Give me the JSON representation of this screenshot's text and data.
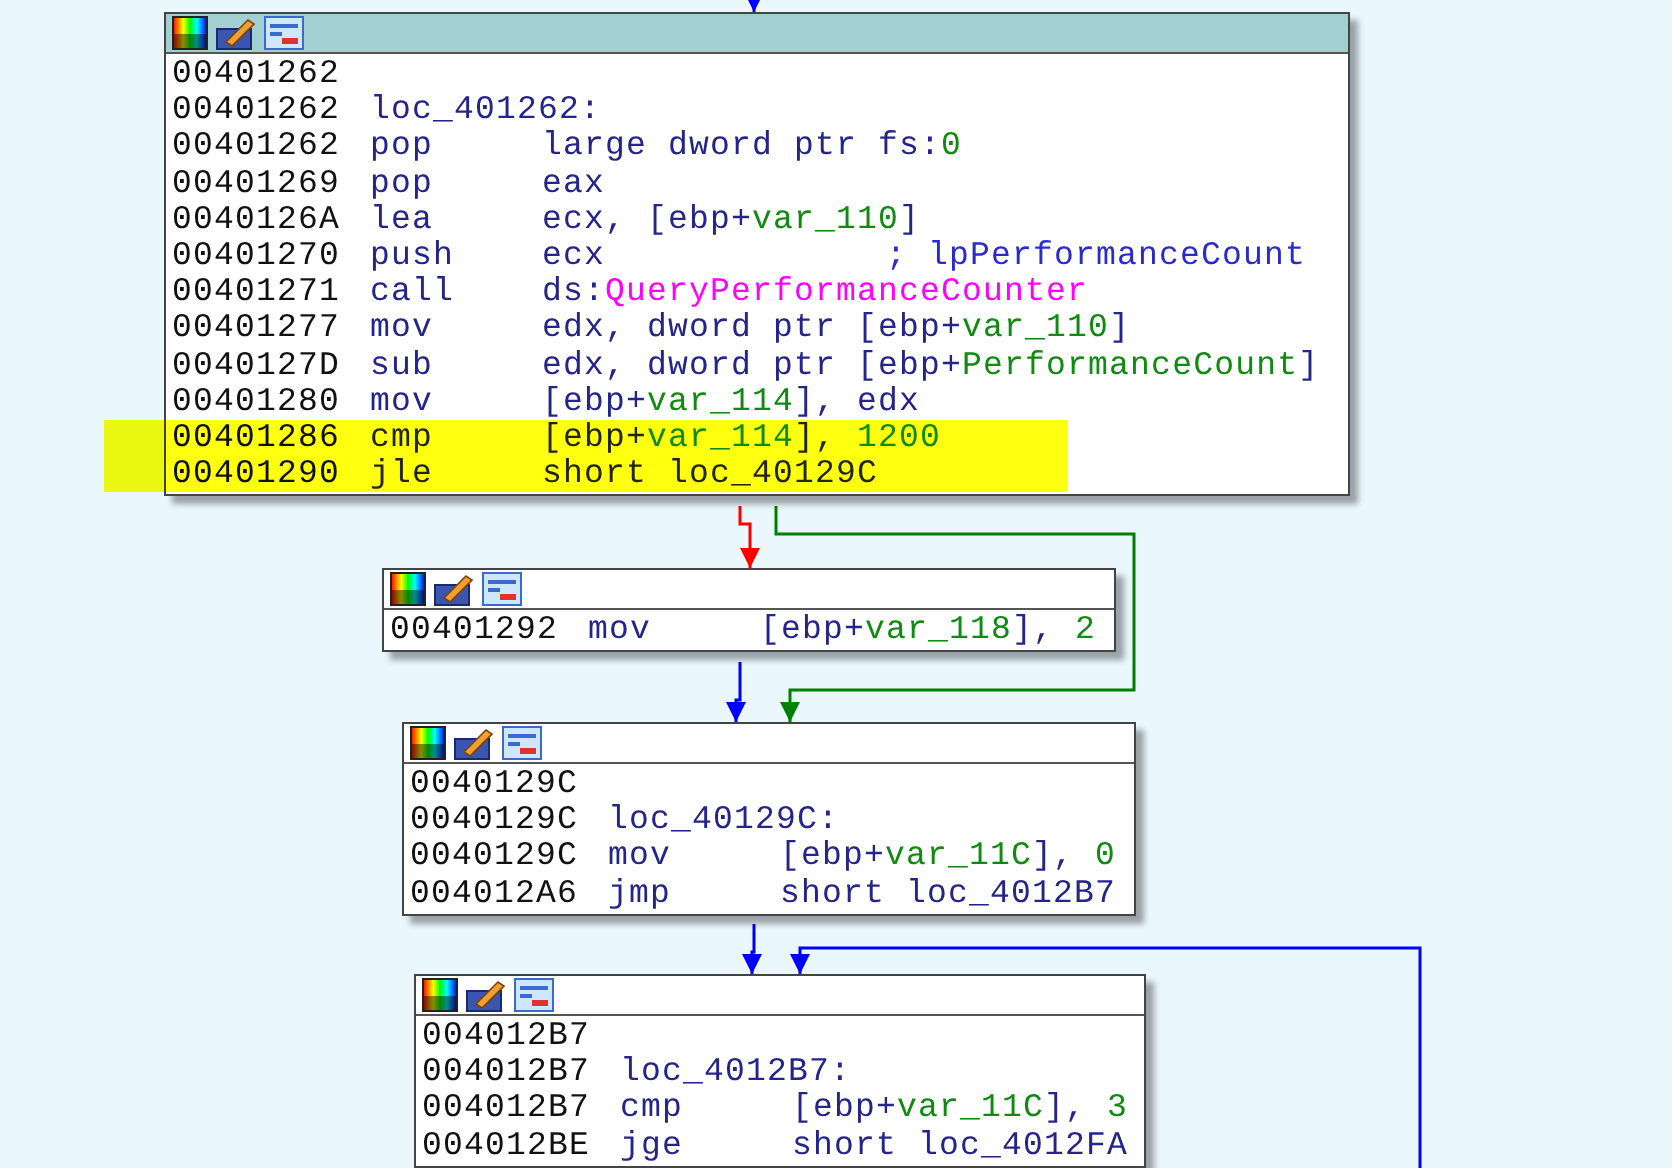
{
  "blocks": [
    {
      "selected": true,
      "lines": [
        {
          "kind": "addr",
          "address": "00401262",
          "highlighted": false
        },
        {
          "kind": "label",
          "address": "00401262",
          "label": "loc_401262:",
          "highlighted": false
        },
        {
          "kind": "ins",
          "address": "00401262",
          "mnemonic": "pop",
          "operands": [
            {
              "kind": "plain",
              "text": "large dword ptr fs:"
            },
            {
              "kind": "num",
              "text": "0"
            }
          ],
          "highlighted": false
        },
        {
          "kind": "ins",
          "address": "00401269",
          "mnemonic": "pop",
          "operands": [
            {
              "kind": "plain",
              "text": "eax"
            }
          ],
          "highlighted": false
        },
        {
          "kind": "ins",
          "address": "0040126A",
          "mnemonic": "lea",
          "operands": [
            {
              "kind": "plain",
              "text": "ecx, [ebp+"
            },
            {
              "kind": "var",
              "text": "var_110"
            },
            {
              "kind": "plain",
              "text": "]"
            }
          ],
          "highlighted": false
        },
        {
          "kind": "ins",
          "address": "00401270",
          "mnemonic": "push",
          "operands": [
            {
              "kind": "plain",
              "text": "ecx"
            }
          ],
          "comment": "; lpPerformanceCount",
          "highlighted": false
        },
        {
          "kind": "ins",
          "address": "00401271",
          "mnemonic": "call",
          "operands": [
            {
              "kind": "plain",
              "text": "ds:"
            },
            {
              "kind": "func",
              "text": "QueryPerformanceCounter"
            }
          ],
          "highlighted": false
        },
        {
          "kind": "ins",
          "address": "00401277",
          "mnemonic": "mov",
          "operands": [
            {
              "kind": "plain",
              "text": "edx, dword ptr [ebp+"
            },
            {
              "kind": "var",
              "text": "var_110"
            },
            {
              "kind": "plain",
              "text": "]"
            }
          ],
          "highlighted": false
        },
        {
          "kind": "ins",
          "address": "0040127D",
          "mnemonic": "sub",
          "operands": [
            {
              "kind": "plain",
              "text": "edx, dword ptr [ebp+"
            },
            {
              "kind": "var",
              "text": "PerformanceCount"
            },
            {
              "kind": "plain",
              "text": "]"
            }
          ],
          "highlighted": false
        },
        {
          "kind": "ins",
          "address": "00401280",
          "mnemonic": "mov",
          "operands": [
            {
              "kind": "plain",
              "text": "[ebp+"
            },
            {
              "kind": "var",
              "text": "var_114"
            },
            {
              "kind": "plain",
              "text": "], edx"
            }
          ],
          "highlighted": false
        },
        {
          "kind": "ins",
          "address": "00401286",
          "mnemonic": "cmp",
          "operands": [
            {
              "kind": "plain",
              "text": "[ebp+"
            },
            {
              "kind": "var",
              "text": "var_114"
            },
            {
              "kind": "plain",
              "text": "], "
            },
            {
              "kind": "num",
              "text": "1200"
            }
          ],
          "highlighted": true
        },
        {
          "kind": "ins",
          "address": "00401290",
          "mnemonic": "jle",
          "operands": [
            {
              "kind": "plain",
              "text": "short loc_40129C"
            }
          ],
          "highlighted": true
        }
      ]
    },
    {
      "selected": false,
      "lines": [
        {
          "kind": "ins",
          "address": "00401292",
          "mnemonic": "mov",
          "operands": [
            {
              "kind": "plain",
              "text": "[ebp+"
            },
            {
              "kind": "var",
              "text": "var_118"
            },
            {
              "kind": "plain",
              "text": "], "
            },
            {
              "kind": "num",
              "text": "2"
            }
          ],
          "highlighted": false
        }
      ]
    },
    {
      "selected": false,
      "lines": [
        {
          "kind": "addr",
          "address": "0040129C",
          "highlighted": false
        },
        {
          "kind": "label",
          "address": "0040129C",
          "label": "loc_40129C:",
          "highlighted": false
        },
        {
          "kind": "ins",
          "address": "0040129C",
          "mnemonic": "mov",
          "operands": [
            {
              "kind": "plain",
              "text": "[ebp+"
            },
            {
              "kind": "var",
              "text": "var_11C"
            },
            {
              "kind": "plain",
              "text": "], "
            },
            {
              "kind": "num",
              "text": "0"
            }
          ],
          "highlighted": false
        },
        {
          "kind": "ins",
          "address": "004012A6",
          "mnemonic": "jmp",
          "operands": [
            {
              "kind": "plain",
              "text": "short loc_4012B7"
            }
          ],
          "highlighted": false
        }
      ]
    },
    {
      "selected": false,
      "lines": [
        {
          "kind": "addr",
          "address": "004012B7",
          "highlighted": false
        },
        {
          "kind": "label",
          "address": "004012B7",
          "label": "loc_4012B7:",
          "highlighted": false
        },
        {
          "kind": "ins",
          "address": "004012B7",
          "mnemonic": "cmp",
          "operands": [
            {
              "kind": "plain",
              "text": "[ebp+"
            },
            {
              "kind": "var",
              "text": "var_11C"
            },
            {
              "kind": "plain",
              "text": "], "
            },
            {
              "kind": "num",
              "text": "3"
            }
          ],
          "highlighted": false
        },
        {
          "kind": "ins",
          "address": "004012BE",
          "mnemonic": "jge",
          "operands": [
            {
              "kind": "plain",
              "text": "short loc_4012FA"
            }
          ],
          "highlighted": false
        }
      ]
    }
  ],
  "edges": [
    {
      "color": "#0000ff"
    },
    {
      "color": "#ff0000"
    },
    {
      "color": "#008000"
    },
    {
      "color": "#0000ff"
    },
    {
      "color": "#0000ff"
    },
    {
      "color": "#0000ff"
    }
  ]
}
